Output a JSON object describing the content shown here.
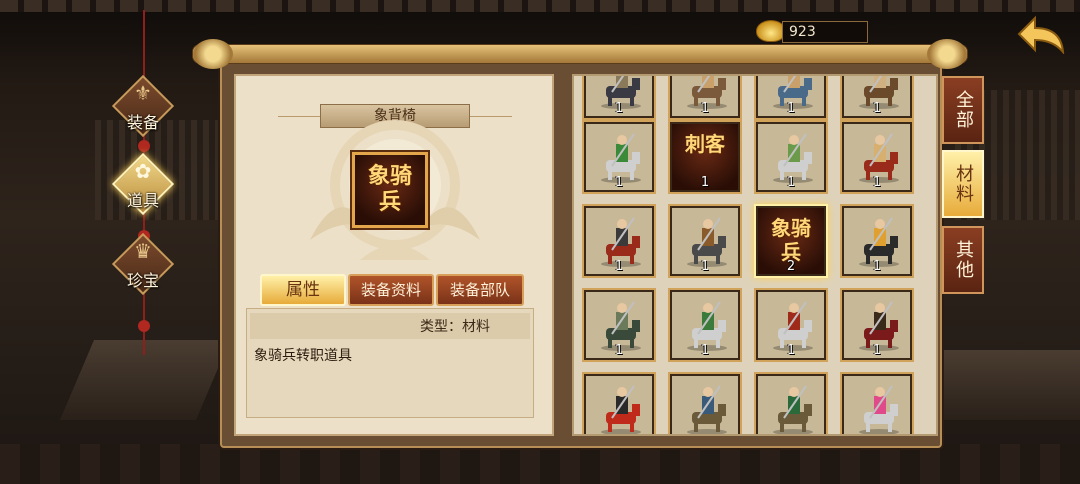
{
  "nav": {
    "items": [
      {
        "label": "装备",
        "icon": "armor-icon",
        "active": false
      },
      {
        "label": "道具",
        "icon": "bag-icon",
        "active": true
      },
      {
        "label": "珍宝",
        "icon": "treasure-icon",
        "active": false
      }
    ]
  },
  "currency": {
    "value": "923",
    "icon": "gold-ingot-icon"
  },
  "detail": {
    "title": "象背椅",
    "item_glyph": [
      "象骑",
      "兵"
    ],
    "tabs": [
      {
        "label": "属性",
        "active": true
      },
      {
        "label": "装备资料",
        "active": false
      },
      {
        "label": "装备部队",
        "active": false
      }
    ],
    "type_text": "类型：材料",
    "description": "象骑兵转职道具"
  },
  "filters": [
    {
      "label": "全部",
      "active": false
    },
    {
      "label": "材料",
      "active": true
    },
    {
      "label": "其他",
      "active": false
    }
  ],
  "grid": {
    "rows": [
      [
        {
          "kind": "sprite",
          "count": "1",
          "palette": [
            "#3a3a44",
            "#8a7a5a"
          ]
        },
        {
          "kind": "sprite",
          "count": "1",
          "palette": [
            "#7a5a3a",
            "#c9a06a"
          ]
        },
        {
          "kind": "sprite",
          "count": "1",
          "palette": [
            "#4a6a8a",
            "#c9a06a"
          ]
        },
        {
          "kind": "sprite",
          "count": "1",
          "palette": [
            "#6a4a2a",
            "#d0b080"
          ]
        }
      ],
      [
        {
          "kind": "sprite",
          "count": "1",
          "palette": [
            "#cfcfcf",
            "#3a8a3a"
          ]
        },
        {
          "kind": "glyph",
          "count": "1",
          "glyph": [
            "刺客",
            ""
          ]
        },
        {
          "kind": "sprite",
          "count": "1",
          "palette": [
            "#cfcfcf",
            "#6a9a4a"
          ]
        },
        {
          "kind": "sprite",
          "count": "1",
          "palette": [
            "#9a2a1a",
            "#d7b070"
          ]
        }
      ],
      [
        {
          "kind": "sprite",
          "count": "1",
          "palette": [
            "#9a2a1a",
            "#3a3a3a"
          ]
        },
        {
          "kind": "sprite",
          "count": "1",
          "palette": [
            "#4a4a4a",
            "#8a5a2a"
          ]
        },
        {
          "kind": "glyph",
          "count": "2",
          "glyph": [
            "象骑",
            "兵"
          ],
          "selected": true
        },
        {
          "kind": "sprite",
          "count": "1",
          "palette": [
            "#2a2a2a",
            "#e0a030"
          ]
        }
      ],
      [
        {
          "kind": "sprite",
          "count": "1",
          "palette": [
            "#3a4a3a",
            "#6a7a5a"
          ]
        },
        {
          "kind": "sprite",
          "count": "1",
          "palette": [
            "#cfcfcf",
            "#3a7a3a"
          ]
        },
        {
          "kind": "sprite",
          "count": "1",
          "palette": [
            "#cfcfcf",
            "#a02a1a"
          ]
        },
        {
          "kind": "sprite",
          "count": "1",
          "palette": [
            "#7a1a1a",
            "#3a2a1a"
          ]
        }
      ],
      [
        {
          "kind": "sprite",
          "count": "",
          "palette": [
            "#c02a1a",
            "#2a2a2a"
          ]
        },
        {
          "kind": "sprite",
          "count": "",
          "palette": [
            "#6a5a3a",
            "#3a5a7a"
          ]
        },
        {
          "kind": "sprite",
          "count": "",
          "palette": [
            "#6a5a3a",
            "#2a6a3a"
          ]
        },
        {
          "kind": "sprite",
          "count": "",
          "palette": [
            "#cfcfcf",
            "#e04a8a"
          ]
        }
      ]
    ]
  }
}
